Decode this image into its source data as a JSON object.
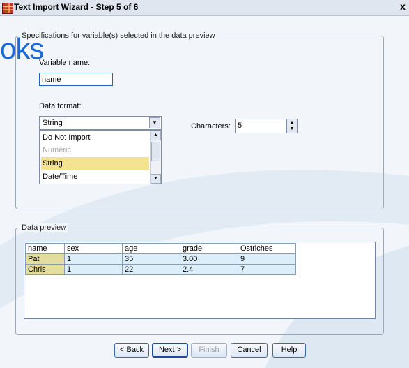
{
  "window": {
    "title": "Text Import Wizard - Step 5 of 6",
    "close_label": "x"
  },
  "watermark": {
    "text": "oks"
  },
  "spec_group": {
    "legend": "Specifications for variable(s) selected in the data preview",
    "variable_name_label": "Variable name:",
    "variable_name_value": "name",
    "data_format_label": "Data format:",
    "data_format_value": "String",
    "data_format_options": [
      "Do Not Import",
      "Numeric",
      "String",
      "Date/Time"
    ],
    "characters_label": "Characters:",
    "characters_value": "5"
  },
  "preview_group": {
    "legend": "Data preview",
    "columns": [
      "name",
      "sex",
      "age",
      "grade",
      "Ostriches"
    ],
    "rows": [
      [
        "Pat",
        "1",
        "35",
        "3.00",
        "9"
      ],
      [
        "Chris",
        "1",
        "22",
        "2.4",
        "7"
      ]
    ]
  },
  "buttons": {
    "back": "< Back",
    "next": "Next >",
    "finish": "Finish",
    "cancel": "Cancel",
    "help": "Help"
  },
  "colors": {
    "selected_item": "#f3e28f",
    "first_column": "#e3dd9e",
    "cell": "#dceefa",
    "accent": "#1a6ad6"
  }
}
